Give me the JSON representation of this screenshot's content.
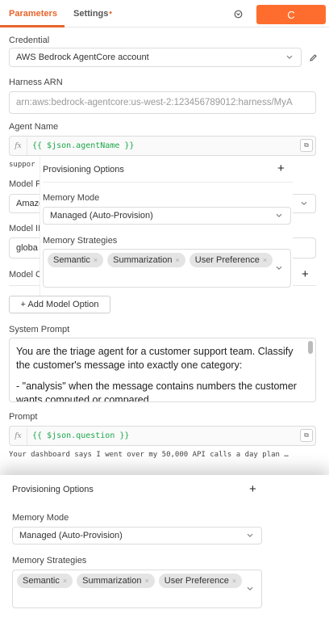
{
  "tabs": {
    "parameters": "Parameters",
    "settings": "Settings",
    "settings_dot": "•"
  },
  "toolbar": {
    "execute_icon": "C"
  },
  "credential": {
    "label": "Credential",
    "value": "AWS Bedrock AgentCore account"
  },
  "harness": {
    "label": "Harness ARN",
    "placeholder": "arn:aws:bedrock-agentcore:us-west-2:123456789012:harness/MyA"
  },
  "agent_name": {
    "label": "Agent Name",
    "expression": "{{ $json.agentName }}",
    "preview": "suppor"
  },
  "model_provider": {
    "label": "Model P",
    "value": "Amazo"
  },
  "model_id": {
    "label": "Model II",
    "value": "globa"
  },
  "model_options": {
    "label": "Model C",
    "add_label": "+ Add Model Option"
  },
  "popover": {
    "title": "Provisioning Options",
    "memory_mode_label": "Memory Mode",
    "memory_mode_value": "Managed (Auto-Provision)",
    "strategies_label": "Memory Strategies",
    "strategies": [
      "Semantic",
      "Summarization",
      "User Preference"
    ]
  },
  "system_prompt": {
    "label": "System Prompt",
    "text": "You are the triage agent for a customer support team. Classify the customer's message into exactly one category:",
    "bullet": "- \"analysis\" when the message contains numbers the customer wants computed or compared"
  },
  "prompt": {
    "label": "Prompt",
    "expression": "{{ $json.question }}",
    "preview": "Your dashboard says I went over my 50,000 API calls a day plan …"
  },
  "panel": {
    "title": "Provisioning Options",
    "memory_mode_label": "Memory Mode",
    "memory_mode_value": "Managed (Auto-Provision)",
    "strategies_label": "Memory Strategies",
    "strategies": [
      "Semantic",
      "Summarization",
      "User Preference"
    ]
  },
  "colors": {
    "accent": "#e8642a",
    "execute": "#ff6d2e",
    "code": "#1ba74a"
  }
}
